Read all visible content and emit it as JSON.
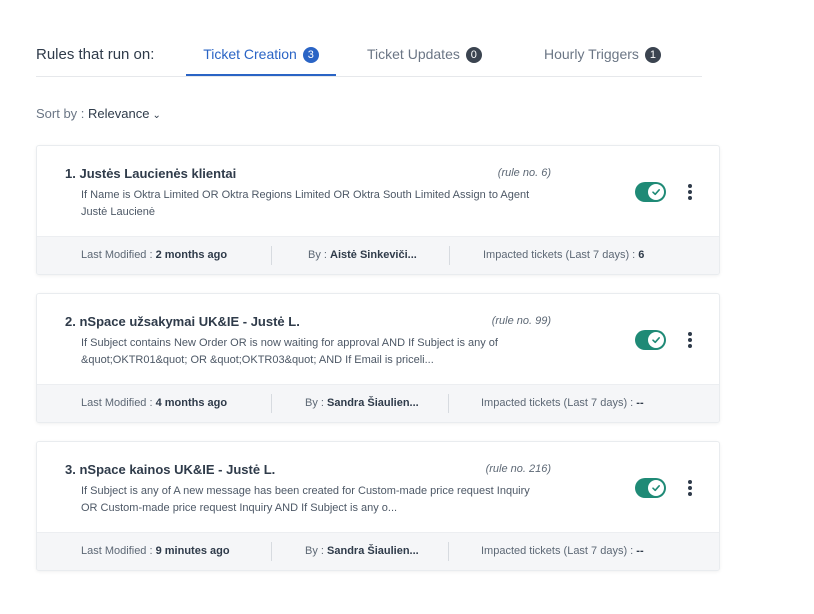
{
  "header": {
    "label": "Rules that run on:",
    "tabs": [
      {
        "label": "Ticket Creation",
        "count": "3"
      },
      {
        "label": "Ticket Updates",
        "count": "0"
      },
      {
        "label": "Hourly Triggers",
        "count": "1"
      }
    ]
  },
  "sort": {
    "label": "Sort by : ",
    "value": "Relevance"
  },
  "colors": {
    "accent": "#2a64c5",
    "toggle_on": "#1f8a76"
  },
  "rules": [
    {
      "number": "1.",
      "title": "Justės Laucienės klientai",
      "rule_no": "(rule no. 6)",
      "description_line1": "If Name is Oktra Limited OR Oktra Regions Limited OR Oktra South Limited Assign to Agent",
      "description_line2": "Justė Laucienė",
      "enabled": true,
      "modified_label": "Last Modified : ",
      "modified_value": "2 months ago",
      "by_label": "By : ",
      "by_value": "Aistė Sinkeviči...",
      "impacted_label": "Impacted tickets (Last 7 days) : ",
      "impacted_value": "6"
    },
    {
      "number": "2.",
      "title": "nSpace užsakymai UK&IE - Justė L.",
      "rule_no": "(rule no. 99)",
      "description_line1": "If Subject contains New Order OR is now waiting for approval AND If Subject is any of",
      "description_line2": "&quot;OKTR01&quot; OR &quot;OKTR03&quot; AND If Email is priceli...",
      "enabled": true,
      "modified_label": "Last Modified : ",
      "modified_value": "4 months ago",
      "by_label": "By : ",
      "by_value": "Sandra Šiaulien...",
      "impacted_label": "Impacted tickets (Last 7 days) : ",
      "impacted_value": "--"
    },
    {
      "number": "3.",
      "title": "nSpace kainos UK&IE - Justė L.",
      "rule_no": "(rule no. 216)",
      "description_line1": "If Subject is any of A new message has been created for Custom-made price request Inquiry",
      "description_line2": "OR Custom-made price request Inquiry AND If Subject is any o...",
      "enabled": true,
      "modified_label": "Last Modified : ",
      "modified_value": "9 minutes ago",
      "by_label": "By : ",
      "by_value": "Sandra Šiaulien...",
      "impacted_label": "Impacted tickets (Last 7 days) : ",
      "impacted_value": "--"
    }
  ]
}
